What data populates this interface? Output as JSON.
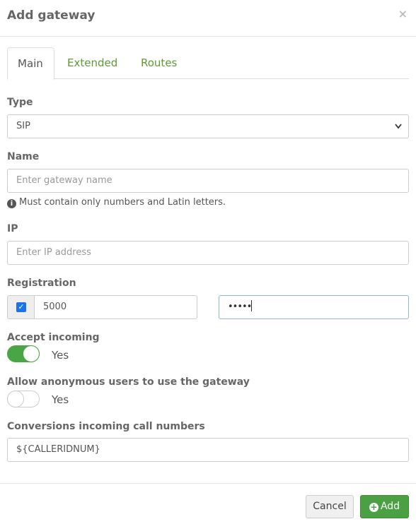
{
  "modal": {
    "title": "Add gateway",
    "close": "×"
  },
  "tabs": [
    {
      "label": "Main",
      "active": true
    },
    {
      "label": "Extended",
      "active": false
    },
    {
      "label": "Routes",
      "active": false
    }
  ],
  "type": {
    "label": "Type",
    "value": "SIP"
  },
  "name": {
    "label": "Name",
    "placeholder": "Enter gateway name",
    "value": "",
    "hint": "Must contain only numbers and Latin letters."
  },
  "ip": {
    "label": "IP",
    "placeholder": "Enter IP address",
    "value": ""
  },
  "registration": {
    "label": "Registration",
    "checked": true,
    "login": "5000",
    "password": "•••••"
  },
  "accept_incoming": {
    "label": "Accept incoming",
    "on": true,
    "text": "Yes"
  },
  "anonymous": {
    "label": "Allow anonymous users to use the gateway",
    "on": false,
    "text": "Yes"
  },
  "conversions": {
    "label": "Conversions incoming call numbers",
    "value": "${CALLERIDNUM}"
  },
  "footer": {
    "cancel": "Cancel",
    "add": "Add"
  },
  "colors": {
    "accent": "#4aa043",
    "link": "#5c9a34",
    "checkbox": "#1a73e8"
  }
}
